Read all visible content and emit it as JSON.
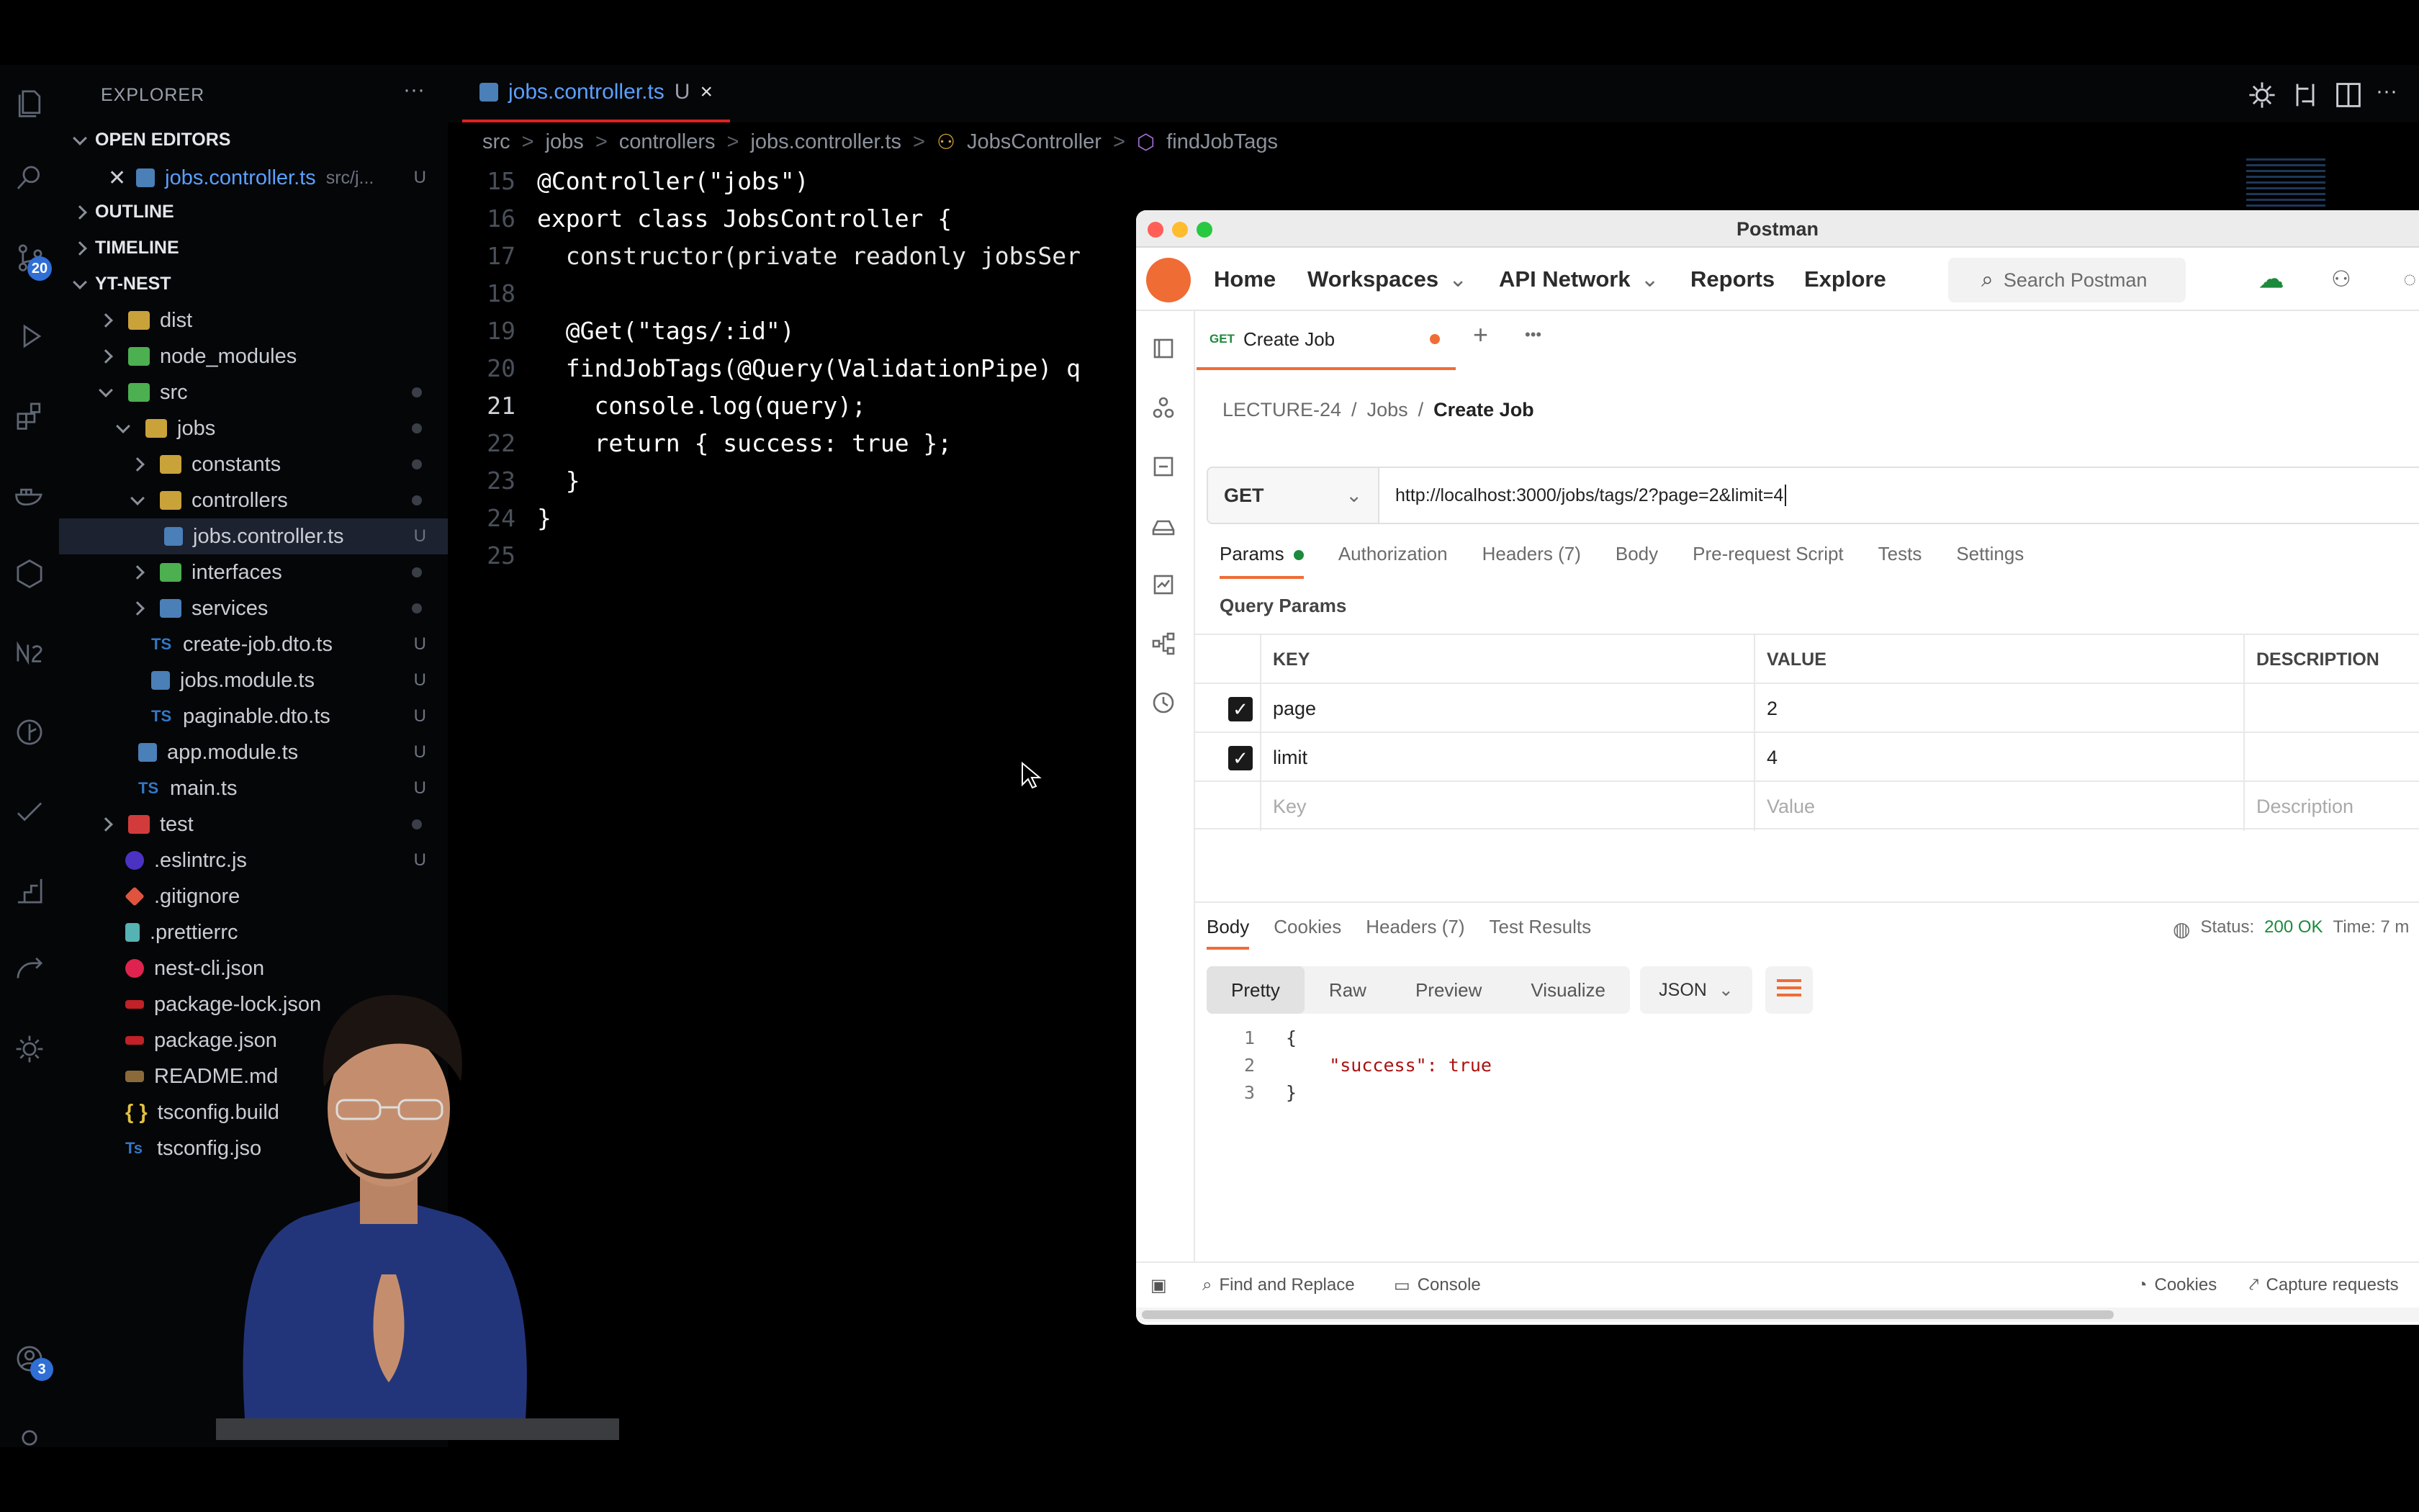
{
  "explorer": {
    "title": "EXPLORER",
    "more": "···",
    "open_editors": "OPEN EDITORS",
    "open_file": "jobs.controller.ts",
    "open_file_path": "src/j...",
    "open_file_status": "U",
    "outline": "OUTLINE",
    "timeline": "TIMELINE",
    "project": "YT-NEST",
    "tree": [
      {
        "label": "dist",
        "status": ""
      },
      {
        "label": "node_modules",
        "status": ""
      },
      {
        "label": "src",
        "status": "•"
      },
      {
        "label": "jobs",
        "status": "•"
      },
      {
        "label": "constants",
        "status": "•"
      },
      {
        "label": "controllers",
        "status": "•"
      },
      {
        "label": "jobs.controller.ts",
        "status": "U"
      },
      {
        "label": "interfaces",
        "status": "•"
      },
      {
        "label": "services",
        "status": "•"
      },
      {
        "label": "create-job.dto.ts",
        "status": "U"
      },
      {
        "label": "jobs.module.ts",
        "status": "U"
      },
      {
        "label": "paginable.dto.ts",
        "status": "U"
      },
      {
        "label": "app.module.ts",
        "status": "U"
      },
      {
        "label": "main.ts",
        "status": "U"
      },
      {
        "label": "test",
        "status": "•"
      },
      {
        "label": ".eslintrc.js",
        "status": "U"
      },
      {
        "label": ".gitignore",
        "status": ""
      },
      {
        "label": ".prettierrc",
        "status": ""
      },
      {
        "label": "nest-cli.json",
        "status": ""
      },
      {
        "label": "package-lock.json",
        "status": ""
      },
      {
        "label": "package.json",
        "status": ""
      },
      {
        "label": "README.md",
        "status": ""
      },
      {
        "label": "tsconfig.build",
        "status": ""
      },
      {
        "label": "tsconfig.jso",
        "status": ""
      }
    ]
  },
  "activity": {
    "scm_badge": "20",
    "account_badge": "3"
  },
  "editor": {
    "tab_label": "jobs.controller.ts",
    "tab_status": "U",
    "tab_close": "×",
    "breadcrumb": [
      "src",
      "jobs",
      "controllers",
      "jobs.controller.ts",
      "JobsController",
      "findJobTags"
    ],
    "lines": [
      {
        "n": "15",
        "code": "@Controller(\"jobs\")"
      },
      {
        "n": "16",
        "code": "export class JobsController {"
      },
      {
        "n": "17",
        "code": "  constructor(private readonly jobsSer"
      },
      {
        "n": "18",
        "code": ""
      },
      {
        "n": "19",
        "code": "  @Get(\"tags/:id\")"
      },
      {
        "n": "20",
        "code": "  findJobTags(@Query(ValidationPipe) q"
      },
      {
        "n": "21",
        "code": "    console.log(query);"
      },
      {
        "n": "22",
        "code": "    return { success: true };"
      },
      {
        "n": "23",
        "code": "  }"
      },
      {
        "n": "24",
        "code": "}"
      },
      {
        "n": "25",
        "code": ""
      }
    ]
  },
  "postman": {
    "window_title": "Postman",
    "nav": {
      "home": "Home",
      "workspaces": "Workspaces",
      "api_network": "API Network",
      "reports": "Reports",
      "explore": "Explore",
      "search": "Search Postman"
    },
    "tab": {
      "method": "GET",
      "label": "Create Job",
      "plus": "+",
      "more": "•••"
    },
    "breadcrumb": [
      "LECTURE-24",
      "/",
      "Jobs",
      "/",
      "Create Job"
    ],
    "method": "GET",
    "url": "http://localhost:3000/jobs/tags/2?page=2&limit=4",
    "request_tabs": [
      "Params",
      "Authorization",
      "Headers (7)",
      "Body",
      "Pre-request Script",
      "Tests",
      "Settings"
    ],
    "query_params_label": "Query Params",
    "columns": [
      "KEY",
      "VALUE",
      "DESCRIPTION"
    ],
    "params": [
      {
        "key": "page",
        "value": "2",
        "description": ""
      },
      {
        "key": "limit",
        "value": "4",
        "description": ""
      }
    ],
    "placeholders": {
      "key": "Key",
      "value": "Value",
      "description": "Description"
    },
    "response_tabs": [
      "Body",
      "Cookies",
      "Headers (7)",
      "Test Results"
    ],
    "status_label": "Status:",
    "status_value": "200 OK",
    "time_label": "Time: 7 m",
    "format_tabs": [
      "Pretty",
      "Raw",
      "Preview",
      "Visualize"
    ],
    "format": "JSON",
    "response_lines": [
      {
        "n": "1",
        "code": "{"
      },
      {
        "n": "2",
        "code": "    \"success\": true"
      },
      {
        "n": "3",
        "code": "}"
      }
    ],
    "footer": {
      "find_replace": "Find and Replace",
      "console": "Console",
      "cookies": "Cookies",
      "capture": "Capture requests"
    }
  },
  "colors": {
    "accent": "#ef6c35",
    "status_ok": "#1c8a3c",
    "tab_underline": "#e02020"
  }
}
